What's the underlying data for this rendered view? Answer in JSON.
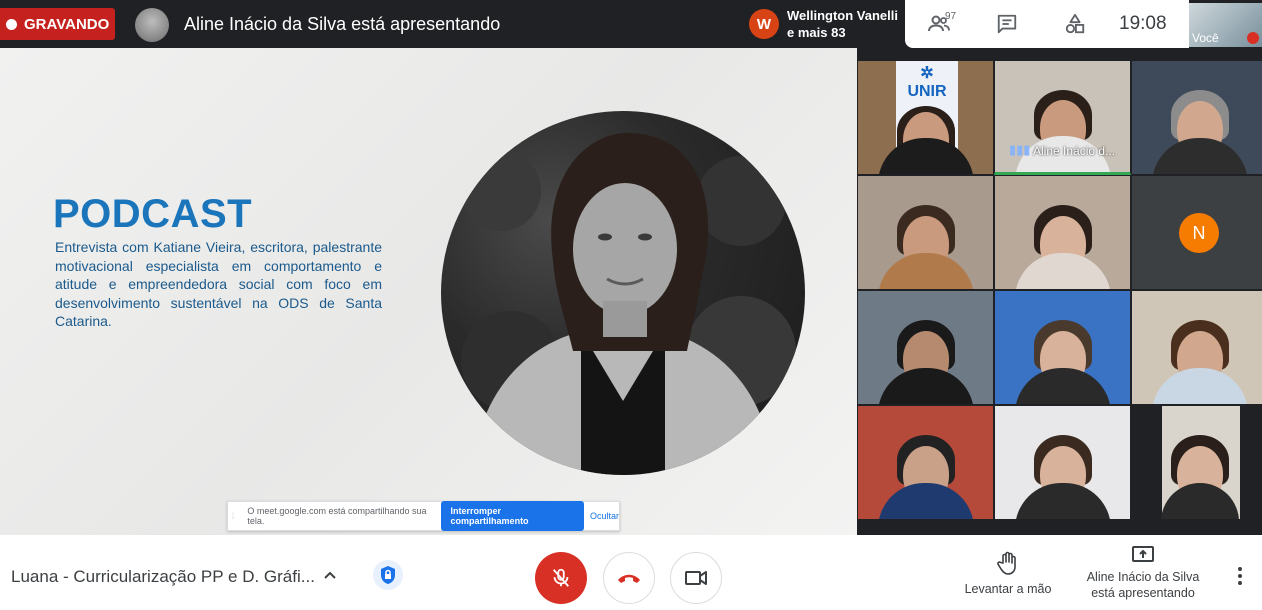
{
  "topbar": {
    "recording_label": "GRAVANDO",
    "presenting_title": "Aline Inácio da Silva está apresentando",
    "speaker": {
      "initial": "W",
      "name": "Wellington Vanelli",
      "others": "e mais 83",
      "avatar_color": "#d84315"
    },
    "participants_count": "97",
    "icons": [
      "people-icon",
      "chat-icon",
      "activities-icon"
    ],
    "clock": "19:08",
    "self_label": "Você"
  },
  "slide": {
    "title": "PODCAST",
    "description": "Entrevista com Katiane Vieira, escritora, palestrante motivacional especialista em comportamento e atitude e empreendedora social com foco em desenvolvimento sustentável na ODS de Santa Catarina.",
    "title_color": "#1b75bb"
  },
  "share_notice": {
    "text": "O meet.google.com está compartilhando sua tela.",
    "stop_label": "Interromper compartilhamento",
    "hide_label": "Ocultar"
  },
  "grid": {
    "active_tile_name": "Aline Inácio d...",
    "n_avatar_initial": "N",
    "unir_logo_text": "UNIR"
  },
  "bottombar": {
    "meeting_title": "Luana - Curricularização PP e D. Gráfi...",
    "raise_hand_label": "Levantar a mão",
    "presenting_line1": "Aline Inácio da Silva",
    "presenting_line2": "está apresentando",
    "colors": {
      "danger": "#d93025",
      "accent": "#1a73e8"
    }
  }
}
